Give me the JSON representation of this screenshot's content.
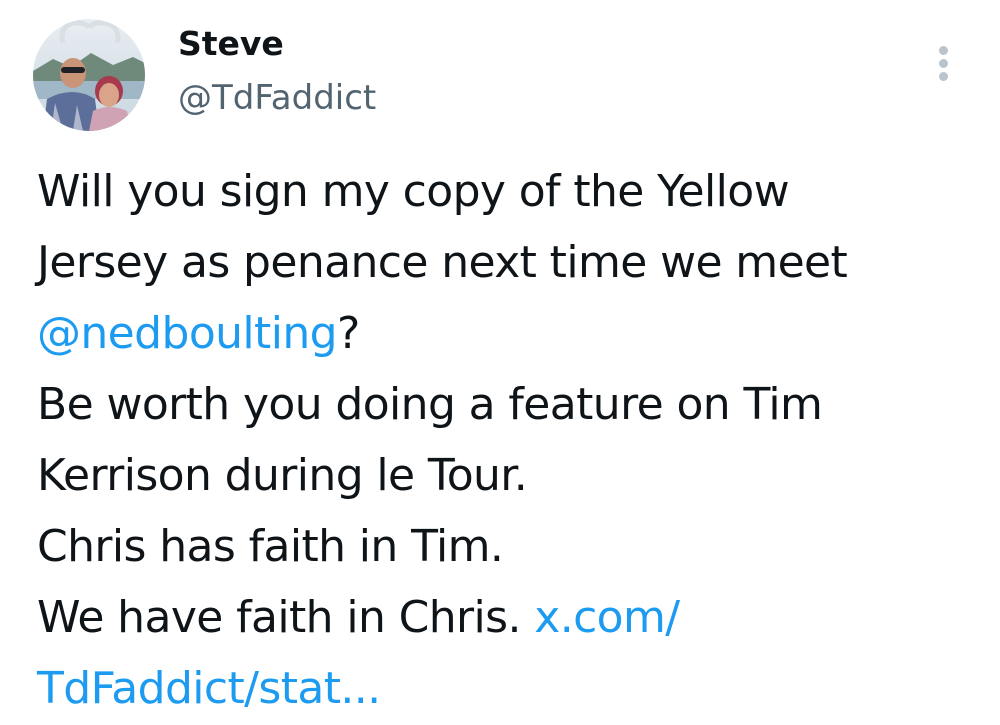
{
  "tweet": {
    "author": {
      "display_name": "Steve",
      "handle": "@TdFaddict"
    },
    "menu_icon": "more-vertical-icon",
    "body": {
      "line1": "Will you sign my copy of the Yellow",
      "line2": "Jersey as penance next time we meet",
      "mention": "@nedboulting",
      "mention_suffix": "?",
      "line4": "Be worth you doing a feature on Tim",
      "line5": "Kerrison during le Tour.",
      "line6": "Chris has faith in Tim.",
      "line7_text": "We have faith in Chris. ",
      "link_part1": "x.com/",
      "link_part2": "TdFaddict/stat..."
    },
    "colors": {
      "text": "#0f1419",
      "secondary": "#536471",
      "link": "#1d9bf0",
      "menu_dots": "#b9c4cc"
    }
  }
}
